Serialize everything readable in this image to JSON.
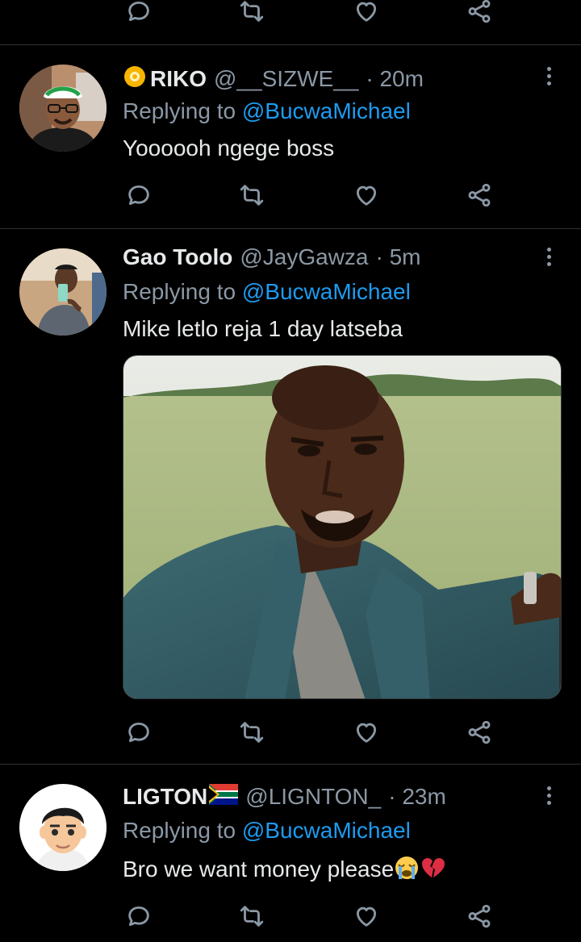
{
  "reply_label": "Replying to",
  "mention": "@BucwaMichael",
  "icons": {
    "reply": "reply-icon",
    "retweet": "retweet-icon",
    "like": "like-icon",
    "share": "share-icon",
    "more": "more-icon"
  },
  "colors": {
    "background": "#000000",
    "text": "#e7e9ea",
    "secondary": "#8b98a5",
    "link": "#1d9bf0",
    "divider": "#2f3336"
  },
  "tweets": [
    {
      "name": "RIKO",
      "handle": "@__SIZWE__",
      "time": "· 20m",
      "text": "Yoooooh ngege boss",
      "name_prefix_icon": "yellow-circle-emoji"
    },
    {
      "name": "Gao Toolo",
      "handle": "@JayGawza",
      "time": "· 5m",
      "text": "Mike letlo reja 1 day latseba",
      "media": "photo of a man in a denim jacket in a field"
    },
    {
      "name": "LIGTON",
      "handle": "@LIGNTON_",
      "time": "· 23m",
      "text": "Bro we want money please",
      "name_suffix_icon": "south-africa-flag-emoji",
      "text_suffix_icons": [
        "loudly-crying-emoji",
        "broken-heart-emoji"
      ]
    }
  ]
}
